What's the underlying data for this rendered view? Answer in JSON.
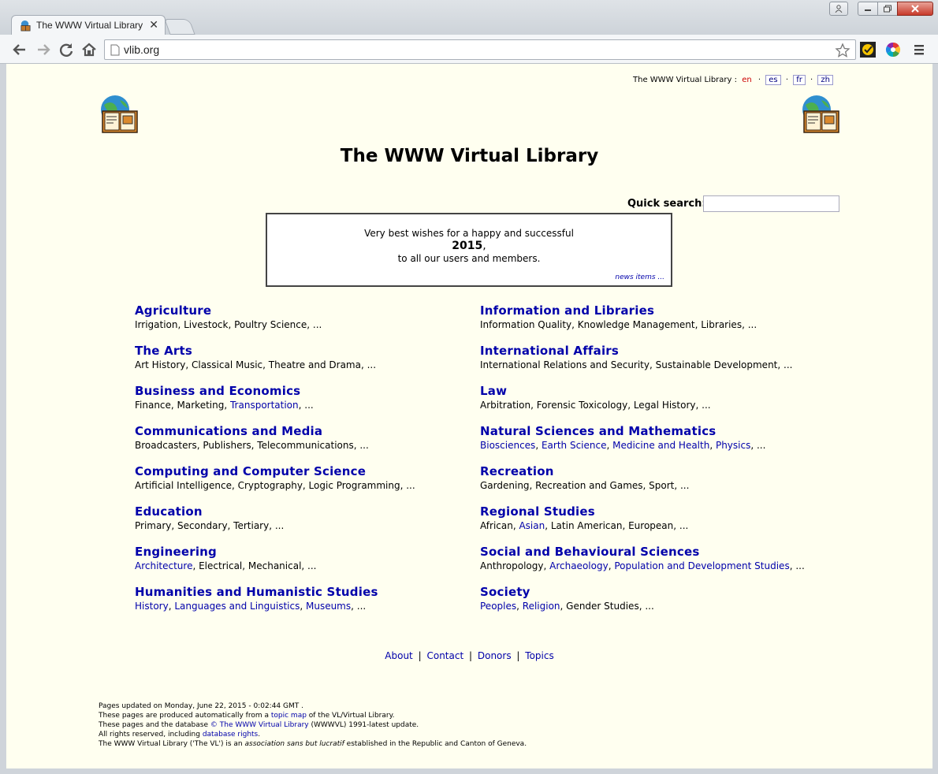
{
  "browser": {
    "tab_title": "The WWW Virtual Library",
    "tab_close": "✕",
    "url": "vlib.org",
    "colors": {
      "close_button": "#c8392a",
      "page_background": "#fffff0",
      "link": "#0000aa"
    }
  },
  "header": {
    "lang_prefix": "The WWW Virtual Library :",
    "lang_current": "en",
    "lang_es": "es",
    "lang_fr": "fr",
    "lang_zh": "zh",
    "dot": "·",
    "title": "The WWW Virtual Library"
  },
  "search": {
    "label": "Quick search:",
    "value": ""
  },
  "news": {
    "line1": "Very best wishes for a happy and successful",
    "year": "2015",
    "comma": ",",
    "line3": "to all our users and members.",
    "link": "news items ..."
  },
  "categories": {
    "left": [
      {
        "title": "Agriculture",
        "subs": [
          {
            "t": "Irrigation, Livestock, Poultry Science, ..."
          }
        ]
      },
      {
        "title": "The Arts",
        "subs": [
          {
            "t": "Art History, Classical Music, Theatre and Drama, ..."
          }
        ]
      },
      {
        "title": "Business and Economics",
        "subs": [
          {
            "t": "Finance, Marketing, "
          },
          {
            "t": "Transportation",
            "l": true
          },
          {
            "t": ", ..."
          }
        ]
      },
      {
        "title": "Communications and Media",
        "subs": [
          {
            "t": "Broadcasters, Publishers, Telecommunications, ..."
          }
        ]
      },
      {
        "title": "Computing and Computer Science",
        "subs": [
          {
            "t": "Artificial Intelligence, Cryptography, Logic Programming, ..."
          }
        ]
      },
      {
        "title": "Education",
        "subs": [
          {
            "t": "Primary, Secondary, Tertiary, ..."
          }
        ]
      },
      {
        "title": "Engineering",
        "subs": [
          {
            "t": "Architecture",
            "l": true
          },
          {
            "t": ", Electrical, Mechanical, ..."
          }
        ]
      },
      {
        "title": "Humanities and Humanistic Studies",
        "subs": [
          {
            "t": "History",
            "l": true
          },
          {
            "t": ", "
          },
          {
            "t": "Languages and Linguistics",
            "l": true
          },
          {
            "t": ", "
          },
          {
            "t": "Museums",
            "l": true
          },
          {
            "t": ", ..."
          }
        ]
      }
    ],
    "right": [
      {
        "title": "Information and Libraries",
        "subs": [
          {
            "t": "Information Quality, Knowledge Management, Libraries, ..."
          }
        ]
      },
      {
        "title": "International Affairs",
        "subs": [
          {
            "t": "International Relations and Security, Sustainable Development, ..."
          }
        ]
      },
      {
        "title": "Law",
        "subs": [
          {
            "t": "Arbitration, Forensic Toxicology, Legal History, ..."
          }
        ]
      },
      {
        "title": "Natural Sciences and Mathematics",
        "subs": [
          {
            "t": "Biosciences",
            "l": true
          },
          {
            "t": ", "
          },
          {
            "t": "Earth Science",
            "l": true
          },
          {
            "t": ", "
          },
          {
            "t": "Medicine and Health",
            "l": true
          },
          {
            "t": ", "
          },
          {
            "t": "Physics",
            "l": true
          },
          {
            "t": ", ..."
          }
        ]
      },
      {
        "title": "Recreation",
        "subs": [
          {
            "t": "Gardening, Recreation and Games, Sport, ..."
          }
        ]
      },
      {
        "title": "Regional Studies",
        "subs": [
          {
            "t": "African, "
          },
          {
            "t": "Asian",
            "l": true
          },
          {
            "t": ", Latin American, European, ..."
          }
        ]
      },
      {
        "title": "Social and Behavioural Sciences",
        "subs": [
          {
            "t": "Anthropology, "
          },
          {
            "t": "Archaeology",
            "l": true
          },
          {
            "t": ", "
          },
          {
            "t": "Population and Development Studies",
            "l": true
          },
          {
            "t": ", ..."
          }
        ]
      },
      {
        "title": "Society",
        "subs": [
          {
            "t": "Peoples",
            "l": true
          },
          {
            "t": ", "
          },
          {
            "t": "Religion",
            "l": true
          },
          {
            "t": ", Gender Studies, ..."
          }
        ]
      }
    ]
  },
  "footer_nav": {
    "about": "About",
    "contact": "Contact",
    "donors": "Donors",
    "topics": "Topics",
    "sep": "|"
  },
  "footer_notes": {
    "l1": "Pages updated on Monday, June 22, 2015 - 0:02:44 GMT .",
    "l2a": "These pages are produced automatically from a ",
    "l2link": "topic map",
    "l2b": " of the VL/Virtual Library.",
    "l3a": "These pages and the database ",
    "l3link": "© The WWW Virtual Library",
    "l3b": " (WWWVL) 1991-latest update.",
    "l4a": "All rights reserved, including ",
    "l4link": "database rights",
    "l4b": ".",
    "l5a": "The WWW Virtual Library ('The VL') is an ",
    "l5em": "association sans but lucratif",
    "l5b": " established in the Republic and Canton of Geneva."
  }
}
